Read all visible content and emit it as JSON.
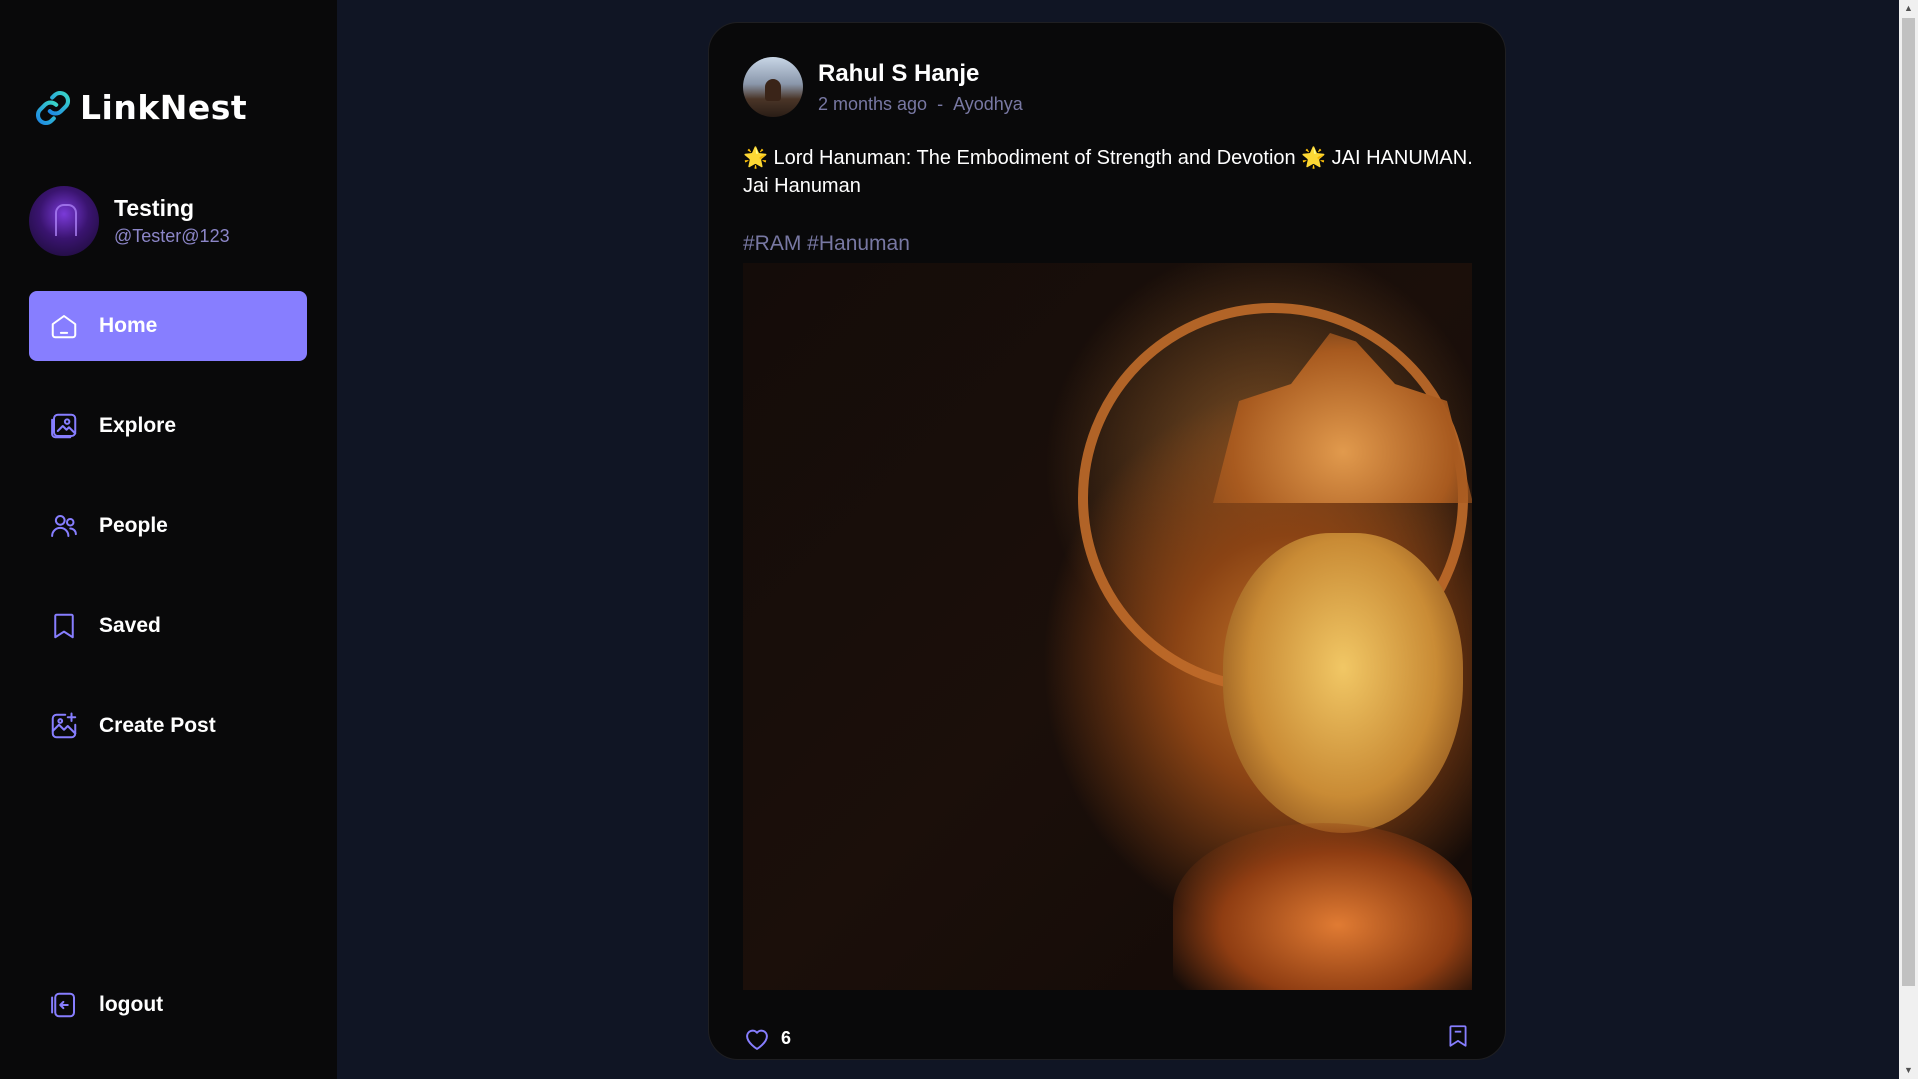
{
  "app": {
    "name": "LinkNest",
    "accent_color": "#877eff"
  },
  "user": {
    "name": "Testing",
    "handle": "@Tester@123"
  },
  "nav": {
    "items": [
      {
        "label": "Home",
        "icon": "home-icon",
        "active": true
      },
      {
        "label": "Explore",
        "icon": "gallery-icon",
        "active": false
      },
      {
        "label": "People",
        "icon": "people-icon",
        "active": false
      },
      {
        "label": "Saved",
        "icon": "bookmark-icon",
        "active": false
      },
      {
        "label": "Create Post",
        "icon": "add-image-icon",
        "active": false
      }
    ],
    "logout_label": "logout"
  },
  "post": {
    "author": "Rahul S Hanje",
    "time": "2 months ago",
    "separator": "-",
    "location": "Ayodhya",
    "caption": "🌟 Lord Hanuman: The Embodiment of Strength and Devotion 🌟 JAI HANUMAN. Jai Hanuman",
    "tags": "#RAM #Hanuman",
    "likes": "6"
  }
}
